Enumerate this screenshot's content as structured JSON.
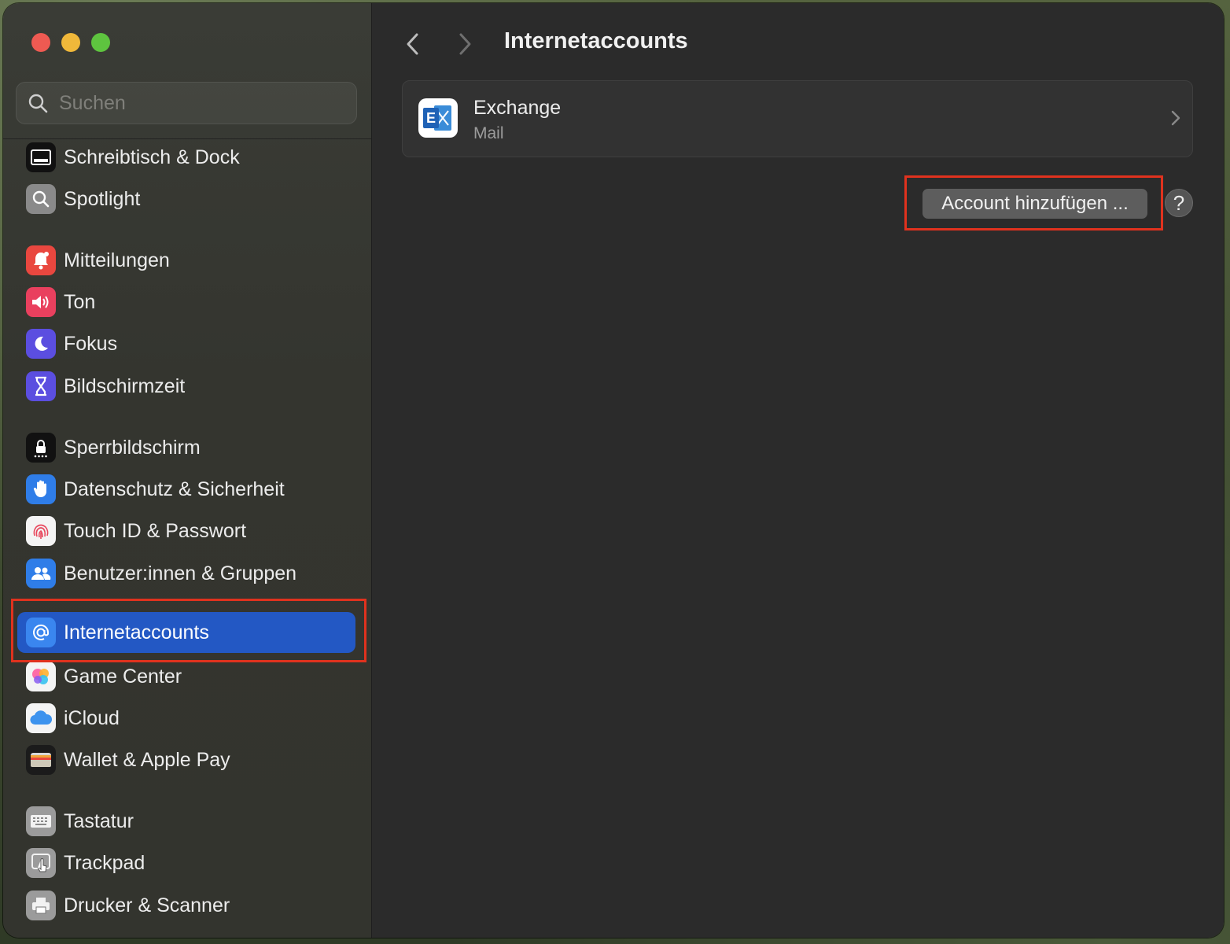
{
  "window": {
    "title": "Internetaccounts"
  },
  "search": {
    "placeholder": "Suchen"
  },
  "sidebar": {
    "items": [
      {
        "label": "Schreibtisch & Dock",
        "icon": "dock-icon"
      },
      {
        "label": "Spotlight",
        "icon": "spotlight-icon"
      },
      {
        "label": "Mitteilungen",
        "icon": "notifications-icon"
      },
      {
        "label": "Ton",
        "icon": "sound-icon"
      },
      {
        "label": "Fokus",
        "icon": "moon-icon"
      },
      {
        "label": "Bildschirmzeit",
        "icon": "hourglass-icon"
      },
      {
        "label": "Sperrbildschirm",
        "icon": "lock-screen-icon"
      },
      {
        "label": "Datenschutz & Sicherheit",
        "icon": "hand-icon"
      },
      {
        "label": "Touch ID & Passwort",
        "icon": "fingerprint-icon"
      },
      {
        "label": "Benutzer:innen & Gruppen",
        "icon": "users-icon"
      },
      {
        "label": "Internetaccounts",
        "icon": "at-icon",
        "selected": true
      },
      {
        "label": "Game Center",
        "icon": "game-center-icon"
      },
      {
        "label": "iCloud",
        "icon": "icloud-icon"
      },
      {
        "label": "Wallet & Apple Pay",
        "icon": "wallet-icon"
      },
      {
        "label": "Tastatur",
        "icon": "keyboard-icon"
      },
      {
        "label": "Trackpad",
        "icon": "trackpad-icon"
      },
      {
        "label": "Drucker & Scanner",
        "icon": "printer-icon"
      }
    ]
  },
  "main": {
    "accounts": [
      {
        "name": "Exchange",
        "services": "Mail",
        "icon": "exchange-icon"
      }
    ],
    "add_button_label": "Account hinzufügen ...",
    "help_label": "?"
  },
  "colors": {
    "selection": "#2358c4",
    "highlight_outline": "#e0321e"
  }
}
